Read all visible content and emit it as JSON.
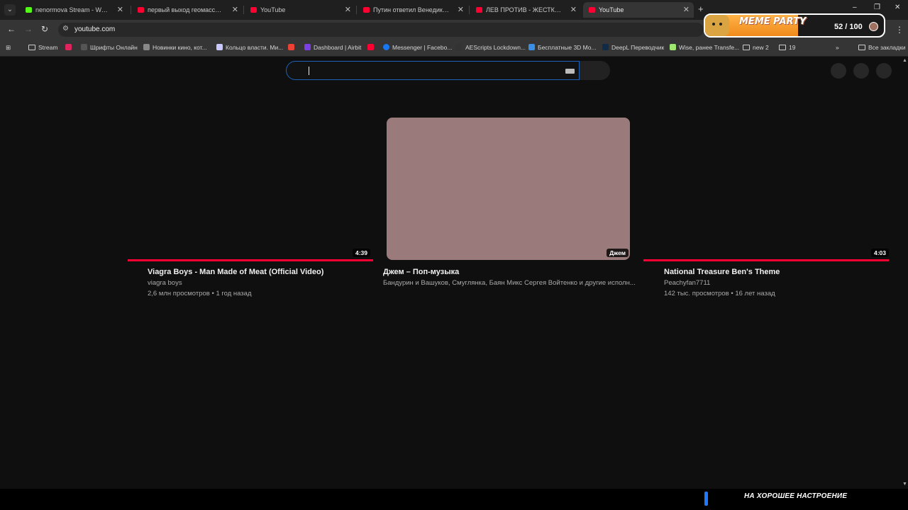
{
  "tabs": [
    {
      "title": "nenormova Stream - Watch Live",
      "favicon": "kick-icon"
    },
    {
      "title": "первый выход геомассыча - YouTube",
      "favicon": "youtube-icon"
    },
    {
      "title": "YouTube",
      "favicon": "youtube-icon"
    },
    {
      "title": "Путин ответил Венедиктову - YouTube",
      "favicon": "youtube-icon"
    },
    {
      "title": "ЛЕВ ПРОТИВ - ЖЕСТКИЙ ТРЭШ",
      "favicon": "youtube-icon"
    },
    {
      "title": "YouTube",
      "favicon": "youtube-icon",
      "active": true
    }
  ],
  "address_bar": {
    "url": "youtube.com"
  },
  "bookmarks": [
    {
      "label": "Stream",
      "icon": "folder-icon"
    },
    {
      "label": "",
      "icon": "app-icon"
    },
    {
      "label": "Шрифты Онлайн",
      "icon": "font-icon"
    },
    {
      "label": "Новинки кино, кот...",
      "icon": "film-icon"
    },
    {
      "label": "Кольцо власти. Ми...",
      "icon": "r-icon"
    },
    {
      "label": "",
      "icon": "gmail-icon"
    },
    {
      "label": "Dashboard | Airbit",
      "icon": "airbit-icon"
    },
    {
      "label": "",
      "icon": "youtube-icon"
    },
    {
      "label": "Messenger | Facebo...",
      "icon": "facebook-icon"
    },
    {
      "label": "AEScripts Lockdown...",
      "icon": "aescripts-icon"
    },
    {
      "label": "Бесплатные 3D Mo...",
      "icon": "3d-icon"
    },
    {
      "label": "DeepL Переводчик",
      "icon": "deepl-icon"
    },
    {
      "label": "Wise, ранее Transfe...",
      "icon": "wise-icon"
    },
    {
      "label": "new 2",
      "icon": "folder-icon"
    },
    {
      "label": "19",
      "icon": "folder-icon"
    }
  ],
  "bookmarks_overflow": "»",
  "all_bookmarks": "Все закладки",
  "meme_party": {
    "title": "MEME PARTY",
    "score": "52 / 100",
    "progress": 0.52
  },
  "search": {
    "placeholder": ""
  },
  "videos": [
    {
      "title": "Viagra Boys - Man Made of Meat (Official Video)",
      "channel": "viagra boys",
      "stats": "2,6 млн просмотров • 1 год назад",
      "duration": "4:39",
      "watched": 1.0
    },
    {
      "title": "Джем – Поп-музыка",
      "channel": "Бандурин и Вашуков, Смуглянка, Баян Микс Сергея Войтенко и другие исполн...",
      "stats": "",
      "duration": "Джем",
      "watched": 0
    },
    {
      "title": "National Treasure Ben's Theme",
      "channel": "Peachyfan7711",
      "stats": "142 тыс. просмотров • 16 лет назад",
      "duration": "4:03",
      "watched": 1.0
    }
  ],
  "bottom_banner": "НА ХОРОШЕЕ НАСТРОЕНИЕ",
  "colors": {
    "background": "#0f0f0f",
    "accent": "#ff0033",
    "search_focus": "#1c62b9"
  }
}
